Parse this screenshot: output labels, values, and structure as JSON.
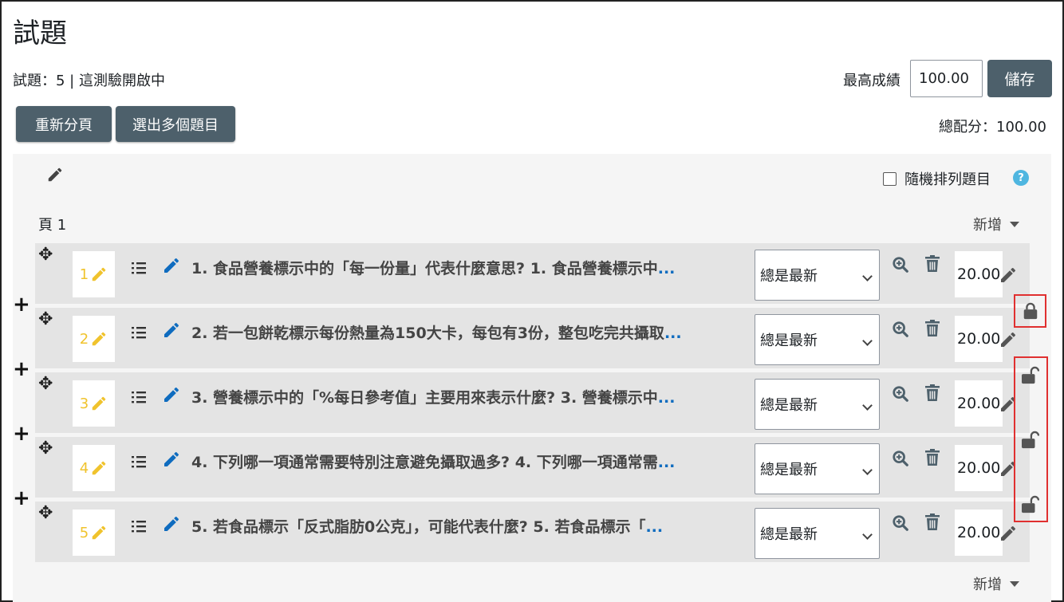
{
  "header": {
    "title": "試題",
    "info": "試題：5 | 這測驗開啟中",
    "max_grade_label": "最高成績",
    "max_grade_value": "100.00",
    "save_label": "儲存",
    "repaginate_label": "重新分頁",
    "select_multiple_label": "選出多個題目",
    "total_marks": "總配分：100.00"
  },
  "section": {
    "shuffle_label": "隨機排列題目",
    "help_symbol": "?",
    "page_label": "頁 1",
    "add_label": "新增",
    "add_label_bottom": "新增"
  },
  "slots": [
    {
      "number": "1",
      "text": "1. 食品營養標示中的「每一份量」代表什麼意思?  1. 食品營養標示中",
      "version": "總是最新",
      "mark": "20.00"
    },
    {
      "number": "2",
      "text": "2. 若一包餅乾標示每份熱量為150大卡，每包有3份，整包吃完共攝取",
      "version": "總是最新",
      "mark": "20.00"
    },
    {
      "number": "3",
      "text": "3. 營養標示中的「%每日參考值」主要用來表示什麼?  3. 營養標示中",
      "version": "總是最新",
      "mark": "20.00"
    },
    {
      "number": "4",
      "text": "4. 下列哪一項通常需要特別注意避免攝取過多?  4. 下列哪一項通常需",
      "version": "總是最新",
      "mark": "20.00"
    },
    {
      "number": "5",
      "text": "5. 若食品標示「反式脂肪0公克」，可能代表什麼?  5. 若食品標示「",
      "version": "總是最新",
      "mark": "20.00"
    }
  ],
  "ellipsis": "...",
  "icons": {
    "move": "move-icon",
    "pencil": "pencil-icon",
    "list": "list-icon",
    "zoom": "zoom-in-icon",
    "trash": "trash-icon",
    "lock": "lock-icon",
    "unlock": "unlock-icon",
    "plus": "plus-icon"
  },
  "colors": {
    "button_bg": "#4d606b",
    "slot_bg": "#e4e4e4",
    "section_bg": "#f5f5f5",
    "number_color": "#f0c32d",
    "link_blue": "#0f6cbf",
    "highlight_red": "#e03030"
  }
}
